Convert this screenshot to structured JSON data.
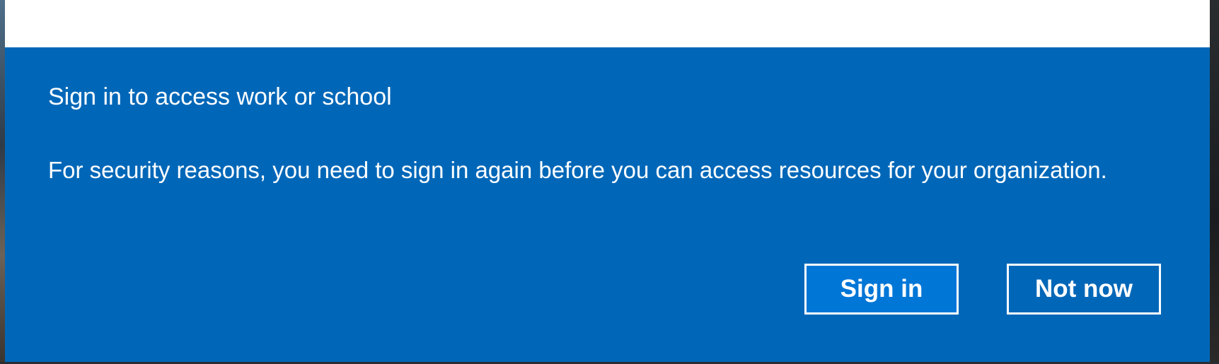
{
  "dialog": {
    "title": "Sign in to access work or school",
    "message": "For security reasons, you need to sign in again before you can access resources for your organization.",
    "primary_button_label": "Sign in",
    "secondary_button_label": "Not now"
  },
  "colors": {
    "accent_background": "#0067b8",
    "primary_button_fill": "#0076d7",
    "text": "#ffffff",
    "window_top": "#ffffff"
  }
}
